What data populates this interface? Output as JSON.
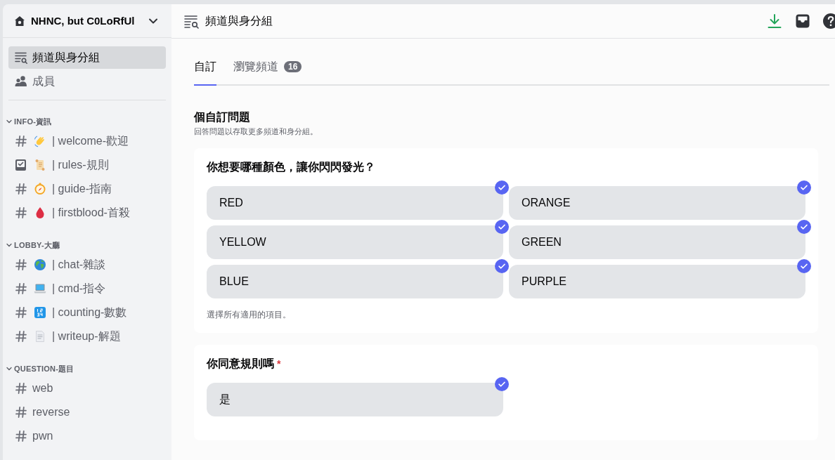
{
  "server": {
    "name": "NHNC, but C0LoRfUl"
  },
  "nav": [
    {
      "kind": "browse",
      "label": "頻道與身分組",
      "selected": true
    },
    {
      "kind": "members",
      "label": "成員",
      "selected": false
    }
  ],
  "categories": [
    {
      "name": "INFO-資訊",
      "expanded": true,
      "channels": [
        {
          "kind": "text",
          "emoji": {
            "kind": "wave"
          },
          "name": "| welcome-歡迎"
        },
        {
          "kind": "rules",
          "emoji": {
            "kind": "scroll"
          },
          "name": "| rules-規則"
        },
        {
          "kind": "text",
          "emoji": {
            "kind": "compass"
          },
          "name": "| guide-指南"
        },
        {
          "kind": "text",
          "emoji": {
            "kind": "drop"
          },
          "name": "| firstblood-首殺"
        }
      ]
    },
    {
      "name": "LOBBY-大廳",
      "expanded": true,
      "channels": [
        {
          "kind": "text",
          "emoji": {
            "kind": "globe"
          },
          "name": "| chat-雜談"
        },
        {
          "kind": "text",
          "emoji": {
            "kind": "laptop"
          },
          "name": "| cmd-指令"
        },
        {
          "kind": "text",
          "emoji": {
            "kind": "numbers"
          },
          "name": "| counting-數數"
        },
        {
          "kind": "text",
          "emoji": {
            "kind": "page"
          },
          "name": "| writeup-解題"
        }
      ]
    },
    {
      "name": "QUESTION-題目",
      "expanded": true,
      "channels": [
        {
          "kind": "text",
          "name": "web"
        },
        {
          "kind": "text",
          "name": "reverse"
        },
        {
          "kind": "text",
          "name": "pwn"
        }
      ]
    }
  ],
  "header": {
    "title": "頻道與身分組"
  },
  "tabs": [
    {
      "label": "自訂",
      "selected": true
    },
    {
      "label": "瀏覽頻道",
      "selected": false,
      "badge": "16"
    }
  ],
  "section": {
    "title": "個自訂問題",
    "subtitle": "回答問題以存取更多頻道和身分組。"
  },
  "questions": [
    {
      "title": "你想要哪種顏色，讓你閃閃發光？",
      "options": [
        {
          "label": "RED",
          "selected": true
        },
        {
          "label": "ORANGE",
          "selected": true
        },
        {
          "label": "YELLOW",
          "selected": true
        },
        {
          "label": "GREEN",
          "selected": true
        },
        {
          "label": "BLUE",
          "selected": true
        },
        {
          "label": "PURPLE",
          "selected": true
        }
      ],
      "hint": "選擇所有適用的項目。"
    },
    {
      "title": "你同意規則嗎",
      "required_mark": "*",
      "options": [
        {
          "label": "是",
          "selected": true
        }
      ]
    }
  ]
}
